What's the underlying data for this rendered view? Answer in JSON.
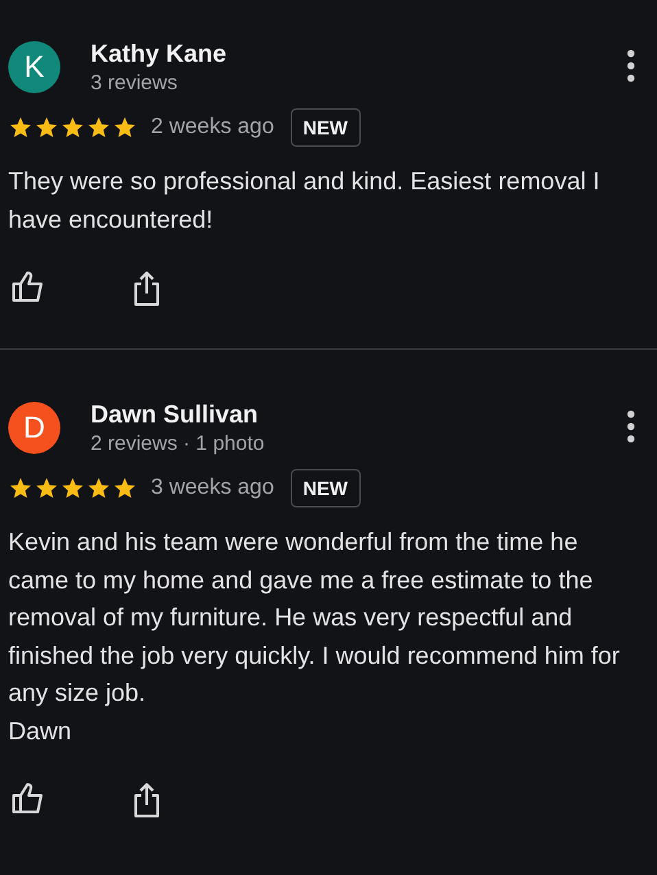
{
  "reviews": [
    {
      "initial": "K",
      "color": "#11897a",
      "name": "Kathy Kane",
      "meta": "3 reviews",
      "stars": 5,
      "time": "2 weeks ago",
      "badge": "NEW",
      "text": "They were so professional and kind. Easiest removal I have encountered!"
    },
    {
      "initial": "D",
      "color": "#f4511e",
      "name": "Dawn Sullivan",
      "meta": "2 reviews · 1 photo",
      "stars": 5,
      "time": "3 weeks ago",
      "badge": "NEW",
      "text": "Kevin and his team were wonderful from the time he came to my home and gave me a free estimate to the removal of my furniture. He was very respectful and finished the job very quickly. I would recommend him for any size job.\nDawn"
    }
  ]
}
